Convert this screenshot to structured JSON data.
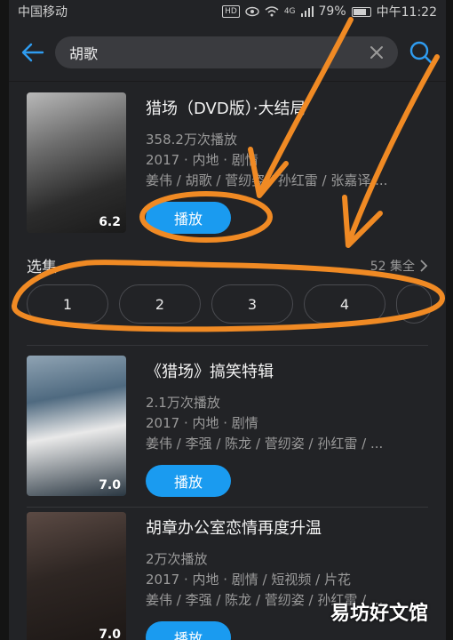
{
  "status_bar": {
    "carrier": "中国移动",
    "network": "4G",
    "battery": "79%",
    "time": "中午11:22"
  },
  "search": {
    "query": "胡歌",
    "icons": {
      "back": "back-arrow-icon",
      "clear": "close-icon",
      "search": "search-icon"
    }
  },
  "results": [
    {
      "title": "猎场（DVD版）·大结局",
      "plays": "358.2万次播放",
      "year_region_genre": "2017 · 内地 · 剧情",
      "cast": "姜伟 / 胡歌 / 菅纫姿 / 孙红雷 / 张嘉译 ...",
      "score": "6.2",
      "play_label": "播放"
    },
    {
      "title": "《猎场》搞笑特辑",
      "plays": "2.1万次播放",
      "year_region_genre": "2017 · 内地 · 剧情",
      "cast": "姜伟 / 李强 / 陈龙 / 菅纫姿 / 孙红雷 / ...",
      "score": "7.0",
      "play_label": "播放"
    },
    {
      "title": "胡章办公室恋情再度升温",
      "plays": "2万次播放",
      "year_region_genre": "2017 · 内地 · 剧情 / 短视频 / 片花",
      "cast": "姜伟 / 李强 / 陈龙 / 菅纫姿 / 孙红雷 / ...",
      "score": "7.0",
      "play_label": "播放"
    }
  ],
  "episodes": {
    "label": "选集",
    "total": "52 集全",
    "items": [
      "1",
      "2",
      "3",
      "4"
    ]
  },
  "colors": {
    "accent": "#1a9bf0",
    "annotation": "#f08a24",
    "background": "#222326"
  },
  "watermark": "易坊好文馆"
}
